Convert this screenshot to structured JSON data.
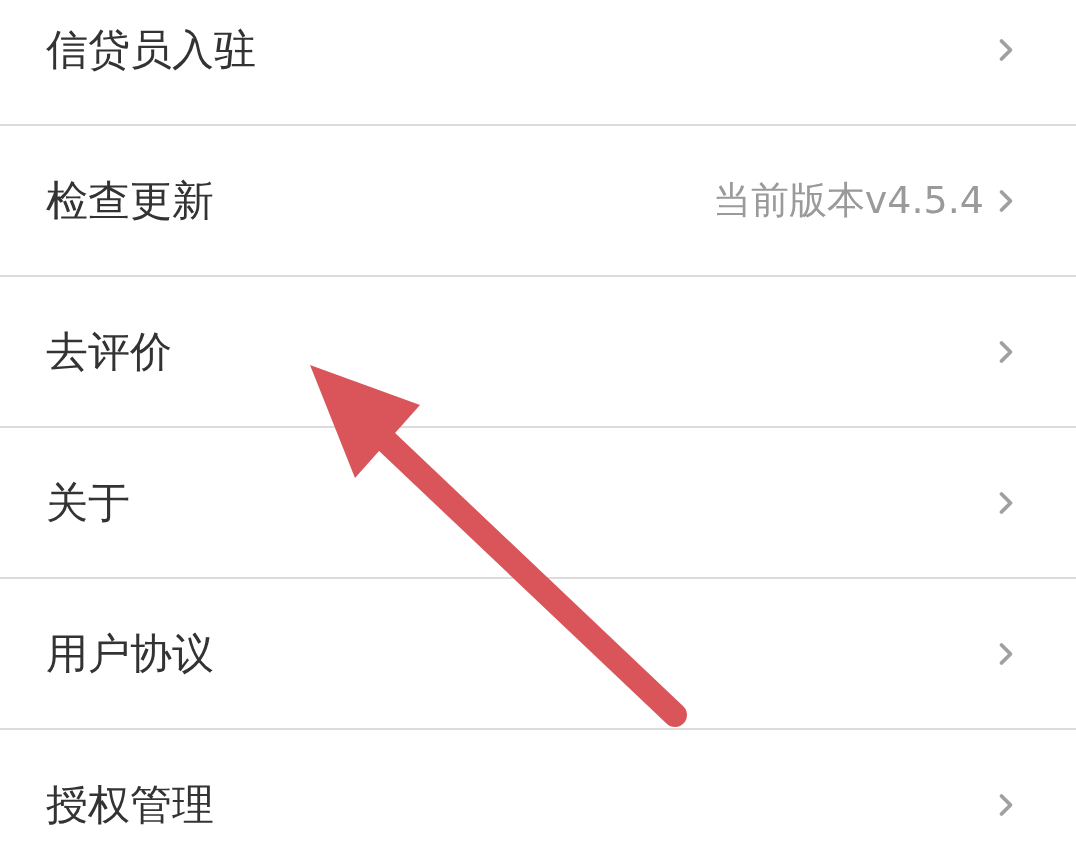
{
  "settings_items": [
    {
      "label": "信贷员入驻"
    },
    {
      "label": "检查更新",
      "value": "当前版本v4.5.4"
    },
    {
      "label": "去评价"
    },
    {
      "label": "关于"
    },
    {
      "label": "用户协议"
    },
    {
      "label": "授权管理"
    }
  ]
}
